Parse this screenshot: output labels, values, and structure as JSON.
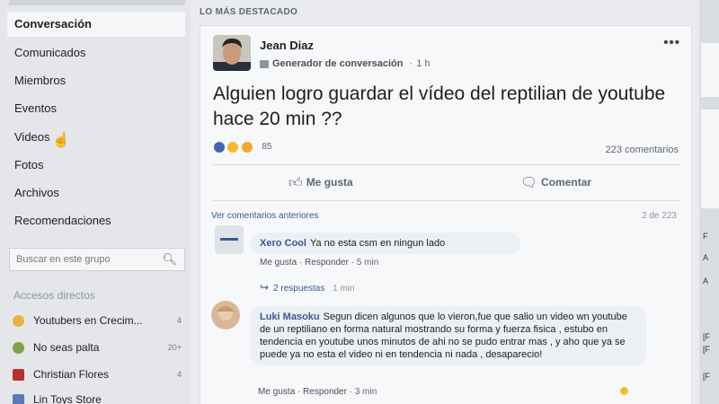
{
  "sidebar": {
    "nav": [
      {
        "label": "Conversación",
        "active": true
      },
      {
        "label": "Comunicados"
      },
      {
        "label": "Miembros"
      },
      {
        "label": "Eventos"
      },
      {
        "label": "Videos"
      },
      {
        "label": "Fotos"
      },
      {
        "label": "Archivos"
      },
      {
        "label": "Recomendaciones"
      }
    ],
    "search_placeholder": "Buscar en este grupo",
    "shortcuts_title": "Accesos directos",
    "shortcuts": [
      {
        "label": "Youtubers en Crecim...",
        "count": "4",
        "color": "#e8b339"
      },
      {
        "label": "No seas palta",
        "count": "20+",
        "color": "#7ea34a"
      },
      {
        "label": "Christian Flores",
        "count": "4",
        "color": "#b7312c"
      },
      {
        "label": "Lin Toys Store",
        "count": "",
        "color": "#5b7bb8"
      }
    ]
  },
  "highlight_title": "LO MÁS DESTACADO",
  "post": {
    "author": "Jean Diaz",
    "role": "Generador de conversación",
    "time": "1 h",
    "text": "Alguien logro guardar el vídeo del reptilian de youtube hace 20 min ??",
    "reaction_count": "85",
    "comment_count": "223 comentarios",
    "like_label": "Me gusta",
    "comment_label": "Comentar",
    "prev_comments": "Ver comentarios anteriores",
    "pager": "2 de 223"
  },
  "comments": [
    {
      "author": "Xero Cool",
      "text": "Ya no esta csm en ningun lado",
      "like": "Me gusta",
      "reply": "Responder",
      "time": "5 min",
      "replies": "2 respuestas",
      "replies_time": "1 min"
    },
    {
      "author": "Luki Masoku",
      "text": "Segun dicen algunos que lo vieron,fue que salio un video wn youtube de un reptiliano en forma natural mostrando su forma y fuerza fisica , estubo en tendencia en youtube unos minutos de ahi no se pudo entrar mas , y aho que ya se puede ya no esta el video ni en tendencia ni nada , desaparecio!",
      "like": "Me gusta",
      "reply": "Responder",
      "time": "3 min"
    }
  ],
  "right_strip": [
    "F",
    "A",
    "A",
    "[F",
    "[F",
    "[F"
  ],
  "colors": {
    "link": "#385898",
    "like_blue": "#4267b2",
    "haha_yellow": "#f7b928"
  }
}
